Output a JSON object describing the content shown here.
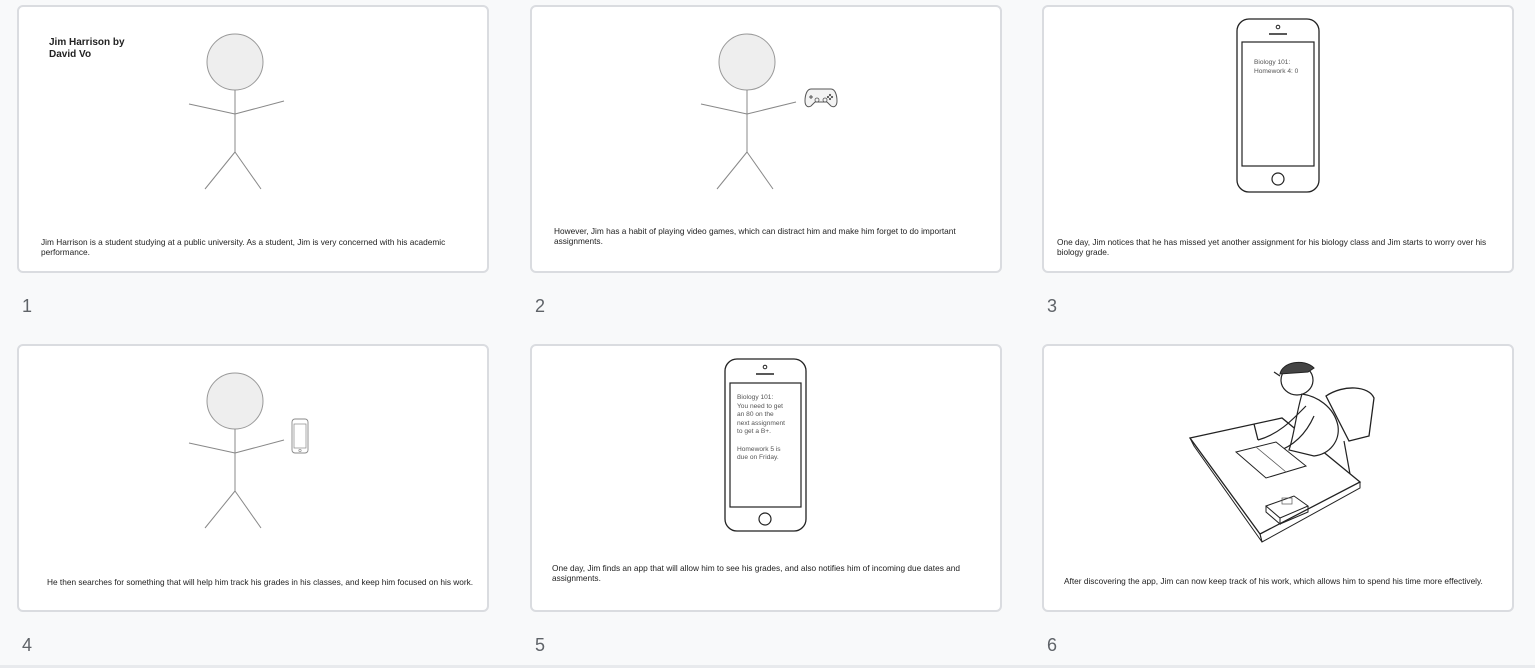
{
  "slides": [
    {
      "number": "1",
      "title": "Jim Harrison by\nDavid Vo",
      "caption": "Jim Harrison is a student studying at a public university. As a student, Jim is very concerned with his academic performance.",
      "icons": [
        "stick-figure"
      ]
    },
    {
      "number": "2",
      "caption": "However, Jim has a habit of playing video games, which can distract him and make him forget to do important assignments.",
      "icons": [
        "stick-figure",
        "game-controller"
      ]
    },
    {
      "number": "3",
      "phone_text": "Biology 101:\nHomework 4: 0",
      "caption": "One day, Jim notices that he has missed yet another assignment for his biology class and Jim starts to worry over his biology grade.",
      "icons": [
        "smartphone"
      ]
    },
    {
      "number": "4",
      "caption": "He then searches for something that will help him track his grades in his classes, and keep him focused on his work.",
      "icons": [
        "stick-figure",
        "smartphone"
      ]
    },
    {
      "number": "5",
      "phone_text": "Biology 101:\nYou need to get\nan 80 on the\nnext assignment\nto get a B+.\n\nHomework 5 is\ndue on Friday.",
      "caption": "One day, Jim finds an app that will allow him to see his grades, and also notifies him of incoming due dates and assignments.",
      "icons": [
        "smartphone"
      ]
    },
    {
      "number": "6",
      "caption": "After discovering the app, Jim can now keep track of his work, which allows him to spend his time more effectively.",
      "icons": [
        "student-studying-illustration"
      ]
    }
  ],
  "colors": {
    "background": "#f8f9fa",
    "slide_border": "#dadce0",
    "number_text": "#5f6368",
    "head_fill": "#eeeeee"
  }
}
